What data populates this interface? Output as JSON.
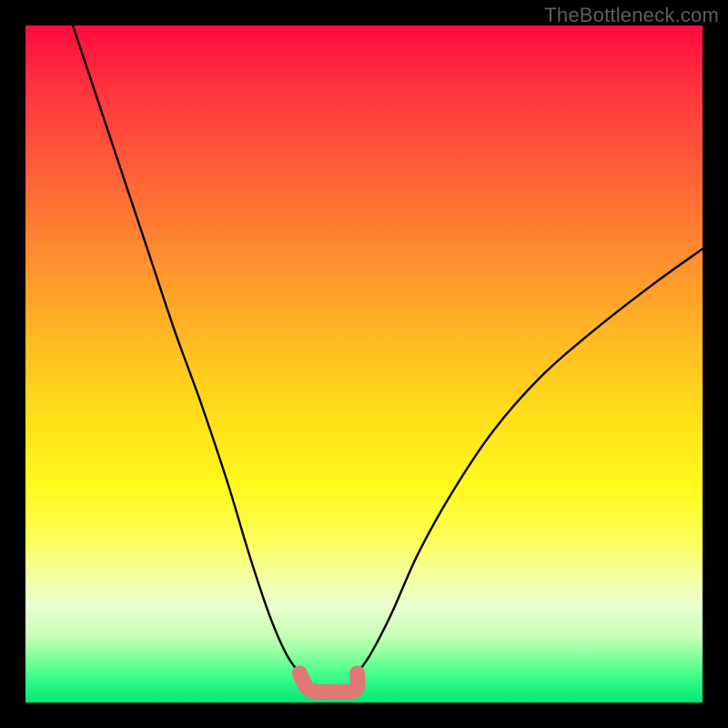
{
  "watermark": "TheBottleneck.com",
  "chart_data": {
    "type": "line",
    "title": "",
    "xlabel": "",
    "ylabel": "",
    "xlim": [
      0,
      100
    ],
    "ylim": [
      0,
      100
    ],
    "series": [
      {
        "name": "left-curve",
        "x": [
          7,
          10,
          14,
          18,
          22,
          26,
          30,
          33,
          36,
          38.5,
          40.5
        ],
        "values": [
          100,
          91,
          79,
          67,
          55,
          44,
          32,
          22,
          13,
          7.2,
          4.3
        ]
      },
      {
        "name": "right-curve",
        "x": [
          49,
          51,
          54,
          58,
          63,
          69,
          76,
          84,
          93,
          100
        ],
        "values": [
          4.3,
          7.2,
          13,
          22,
          31,
          40,
          48,
          55,
          62,
          67
        ]
      },
      {
        "name": "valley-marker",
        "x": [
          40.5,
          41.5,
          43,
          46,
          48,
          49,
          49
        ],
        "values": [
          4.3,
          2.3,
          1.6,
          1.6,
          1.6,
          2.3,
          4.3
        ]
      }
    ],
    "background_gradient": {
      "top": "#ff0b3f",
      "mid_upper": "#ff8a30",
      "mid": "#fff91c",
      "mid_lower": "#e8ffcf",
      "bottom": "#00e876"
    },
    "curve_color": "#000000",
    "marker_color": "#e07878"
  }
}
